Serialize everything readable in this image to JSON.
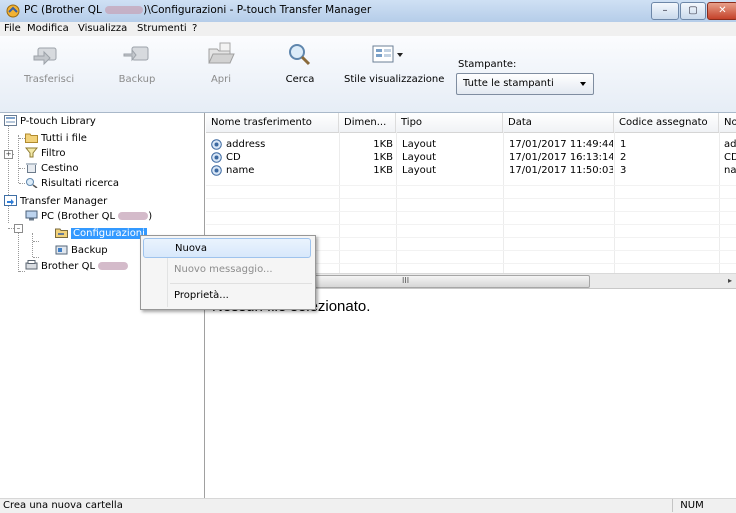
{
  "window": {
    "title_prefix": "PC (Brother QL ",
    "title_suffix": ")\\Configurazioni - P-touch Transfer Manager",
    "min_glyph": "–",
    "max_glyph": "▢",
    "close_glyph": "✕"
  },
  "menu": [
    "File",
    "Modifica",
    "Visualizza",
    "Strumenti",
    "?"
  ],
  "toolbar": {
    "transfer_label": "Trasferisci",
    "backup_label": "Backup",
    "open_label": "Apri",
    "search_label": "Cerca",
    "view_style_label": "Stile visualizzazione",
    "printer_label": "Stampante:",
    "printer_value": "Tutte le stampanti"
  },
  "tree": {
    "library": "P-touch Library",
    "all_files": "Tutti i file",
    "filter": "Filtro",
    "trash": "Cestino",
    "search_results": "Risultati ricerca",
    "transfer_manager": "Transfer Manager",
    "pc_prefix": "PC (Brother QL ",
    "pc_suffix": ")",
    "configurations": "Configurazioni",
    "backup": "Backup",
    "brother_prefix": "Brother QL "
  },
  "list": {
    "columns": [
      "Nome trasferimento",
      "Dimen...",
      "Tipo",
      "Data",
      "Codice assegnato",
      "No"
    ],
    "rows": [
      {
        "name": "address",
        "size": "1KB",
        "type": "Layout",
        "date": "17/01/2017 11:49:44",
        "code": "1",
        "note": "ad"
      },
      {
        "name": "CD",
        "size": "1KB",
        "type": "Layout",
        "date": "17/01/2017 16:13:14",
        "code": "2",
        "note": "CD"
      },
      {
        "name": "name",
        "size": "1KB",
        "type": "Layout",
        "date": "17/01/2017 11:50:03",
        "code": "3",
        "note": "na"
      }
    ],
    "scroll_grip": "III",
    "scroll_arrow": "▸"
  },
  "preview": {
    "text": "Nessun file selezionato."
  },
  "context_menu": {
    "items": [
      {
        "label": "Nuova"
      },
      {
        "label": "Nuovo messaggio..."
      },
      {
        "label": "Proprietà..."
      }
    ]
  },
  "status": {
    "text": "Crea una nuova cartella",
    "num": "NUM"
  },
  "colors": {
    "selection": "#3399ff",
    "titlebar": "#cfe0f4"
  }
}
